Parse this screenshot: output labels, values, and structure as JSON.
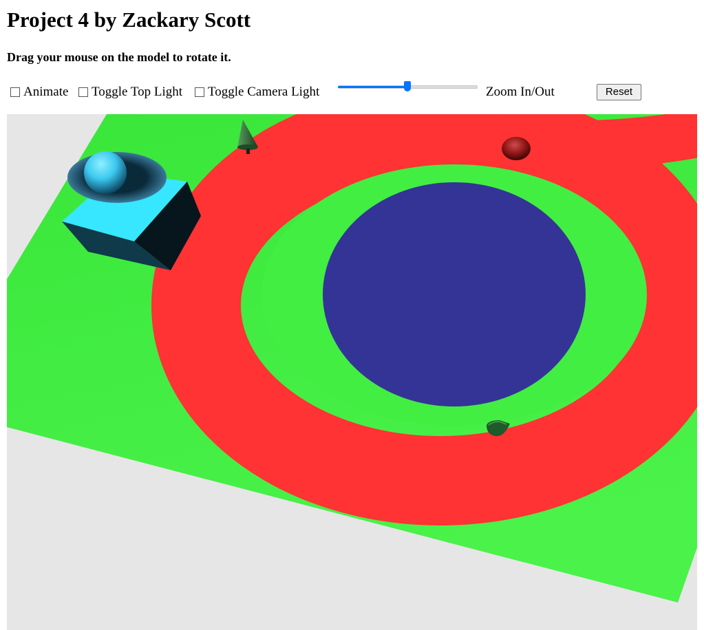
{
  "page": {
    "title": "Project 4 by Zackary Scott",
    "instruction": "Drag your mouse on the model to rotate it."
  },
  "controls": {
    "animate": {
      "label": "Animate",
      "checked": false
    },
    "top_light": {
      "label": "Toggle Top Light",
      "checked": false
    },
    "camera_light": {
      "label": "Toggle Camera Light",
      "checked": false
    },
    "zoom": {
      "label": "Zoom In/Out",
      "value_fraction": 0.5
    },
    "reset": {
      "label": "Reset"
    }
  },
  "scene": {
    "background_color": "#e6e6e6",
    "ground_color": "#42ee42",
    "track_color": "#ff3333",
    "pond_color": "#343496",
    "cube_color": "#37e6ff",
    "sphere_color": "#3cc8f0",
    "red_ball_color": "#9a1a1a",
    "cone_color": "#2a6a3a"
  }
}
